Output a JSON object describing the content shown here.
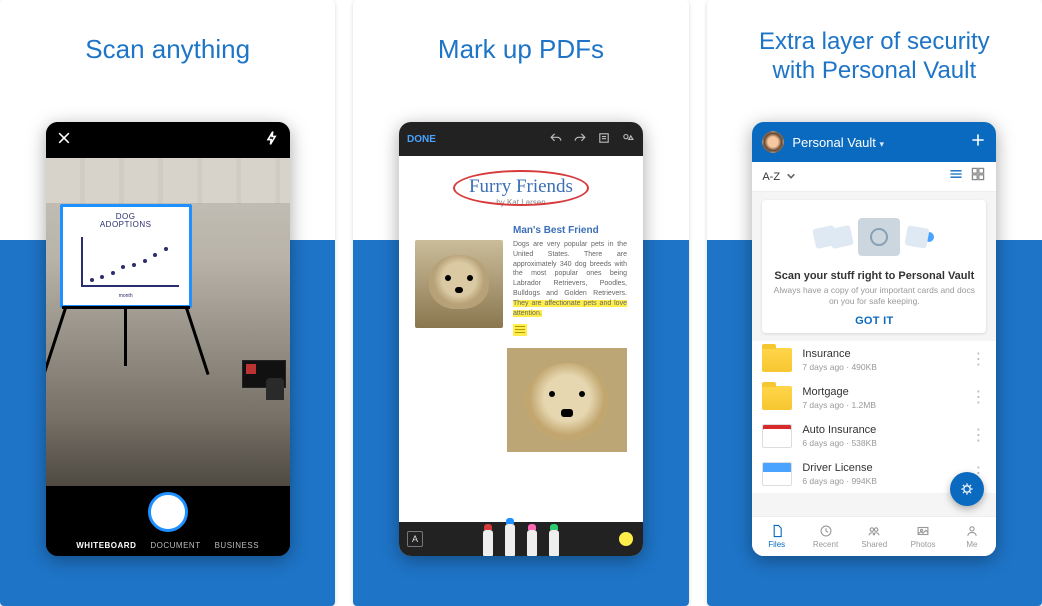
{
  "panels": {
    "scan": {
      "heading": "Scan anything",
      "close": "Close",
      "flash": "Flash auto",
      "board_line1": "DOG",
      "board_line2": "ADOPTIONS",
      "board_xlabel": "month",
      "modes": {
        "active": "WHITEBOARD",
        "m2": "DOCUMENT",
        "m3": "BUSINESS"
      },
      "shutter": "Capture"
    },
    "markup": {
      "heading": "Mark up PDFs",
      "done": "DONE",
      "font_indicator": "A",
      "doc_title": "Furry Friends",
      "doc_sub": "by Kat Larsen",
      "section": "Man's Best Friend",
      "para": "Dogs are very popular pets in the United States. There are approximately 340 dog breeds with the most popular ones being Labrador Retrievers, Poodles, Bulldogs and Golden Retrievers. ",
      "highlight": "They are affectionate pets and love attention."
    },
    "vault": {
      "heading_l1": "Extra layer of security",
      "heading_l2": "with Personal Vault",
      "title": "Personal Vault",
      "sort": "A-Z",
      "card_title": "Scan your stuff right to Personal Vault",
      "card_body": "Always have a copy of your important cards and docs on you for safe keeping.",
      "card_cta": "GOT IT",
      "items": [
        {
          "name": "Insurance",
          "meta": "7 days ago · 490KB",
          "thumb": "folder"
        },
        {
          "name": "Mortgage",
          "meta": "7 days ago · 1.2MB",
          "thumb": "folder"
        },
        {
          "name": "Auto Insurance",
          "meta": "6 days ago · 538KB",
          "thumb": "doc1"
        },
        {
          "name": "Driver License",
          "meta": "6 days ago · 994KB",
          "thumb": "doc2"
        }
      ],
      "tabs": {
        "files": "Files",
        "recent": "Recent",
        "shared": "Shared",
        "photos": "Photos",
        "me": "Me"
      }
    }
  },
  "chart_data": {
    "type": "scatter",
    "title": "DOG ADOPTIONS",
    "xlabel": "month",
    "ylabel": "",
    "x": [
      1,
      2,
      3,
      4,
      5,
      6,
      7,
      8
    ],
    "y": [
      2,
      2.5,
      3,
      3.8,
      4,
      4.5,
      5.2,
      5.8
    ],
    "ylim": [
      0,
      6
    ],
    "xlim": [
      0,
      9
    ]
  }
}
